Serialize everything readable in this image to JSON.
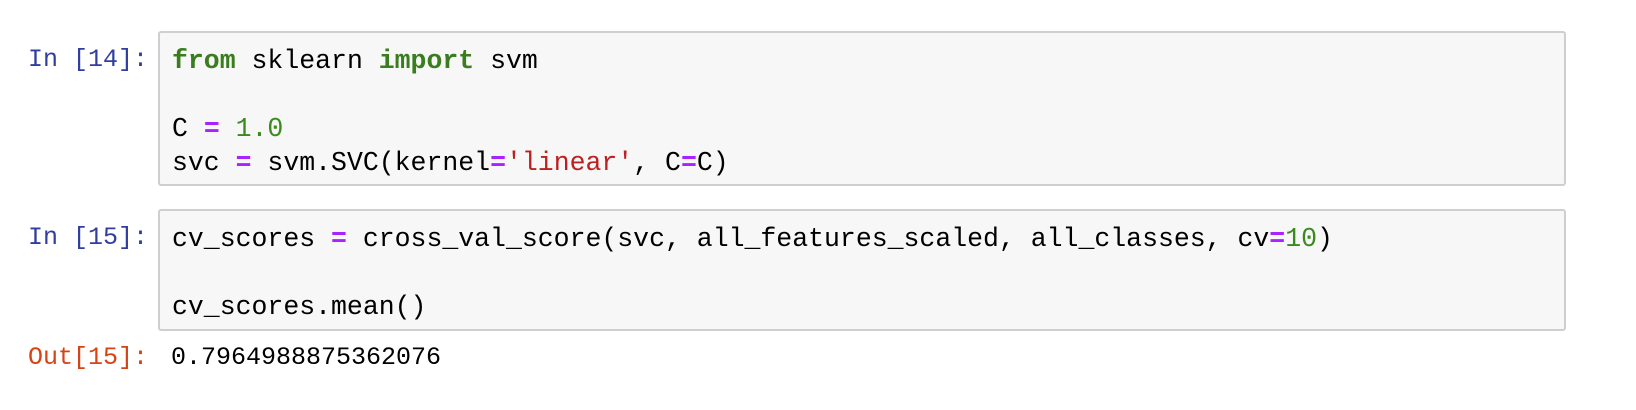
{
  "cells": [
    {
      "prompt": "In [14]:",
      "lines": [
        [
          {
            "t": "from",
            "c": "kw"
          },
          {
            "t": " sklearn ",
            "c": ""
          },
          {
            "t": "import",
            "c": "kw"
          },
          {
            "t": " svm",
            "c": ""
          }
        ],
        [],
        [
          {
            "t": "C ",
            "c": ""
          },
          {
            "t": "=",
            "c": "op"
          },
          {
            "t": " ",
            "c": ""
          },
          {
            "t": "1.0",
            "c": "num"
          }
        ],
        [
          {
            "t": "svc ",
            "c": ""
          },
          {
            "t": "=",
            "c": "op"
          },
          {
            "t": " svm.SVC(kernel",
            "c": ""
          },
          {
            "t": "=",
            "c": "op"
          },
          {
            "t": "'linear'",
            "c": "str"
          },
          {
            "t": ", C",
            "c": ""
          },
          {
            "t": "=",
            "c": "op"
          },
          {
            "t": "C)",
            "c": ""
          }
        ]
      ]
    },
    {
      "prompt": "In [15]:",
      "lines": [
        [
          {
            "t": "cv_scores ",
            "c": ""
          },
          {
            "t": "=",
            "c": "op"
          },
          {
            "t": " cross_val_score(svc, all_features_scaled, all_classes, cv",
            "c": ""
          },
          {
            "t": "=",
            "c": "op"
          },
          {
            "t": "10",
            "c": "num"
          },
          {
            "t": ")",
            "c": ""
          }
        ],
        [],
        [
          {
            "t": "cv_scores.mean()",
            "c": ""
          }
        ]
      ]
    }
  ],
  "output": {
    "prompt": "Out[15]:",
    "value": "0.7964988875362076"
  }
}
